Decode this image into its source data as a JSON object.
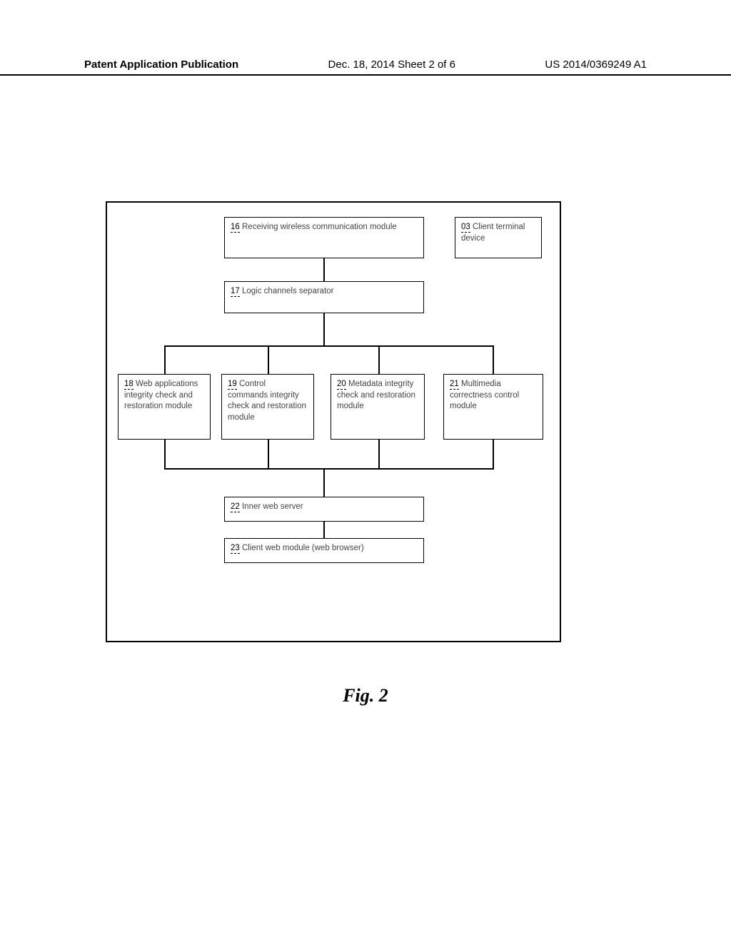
{
  "header": {
    "left": "Patent Application Publication",
    "center": "Dec. 18, 2014  Sheet 2 of 6",
    "right": "US 2014/0369249 A1"
  },
  "figure_caption": "Fig. 2",
  "boxes": {
    "b03": {
      "ref": "03",
      "text": " Client terminal device"
    },
    "b16": {
      "ref": "16",
      "text": " Receiving wireless communication module"
    },
    "b17": {
      "ref": "17",
      "text": " Logic channels separator"
    },
    "b18": {
      "ref": "18",
      "text": " Web applications integrity check and restoration module"
    },
    "b19": {
      "ref": "19",
      "text": " Control commands integrity check and restoration module"
    },
    "b20": {
      "ref": "20",
      "text": " Metadata integrity check and restoration module"
    },
    "b21": {
      "ref": "21",
      "text": " Multimedia correctness control module"
    },
    "b22": {
      "ref": "22",
      "text": " Inner web server"
    },
    "b23": {
      "ref": "23",
      "text": " Client web module (web browser)"
    }
  }
}
